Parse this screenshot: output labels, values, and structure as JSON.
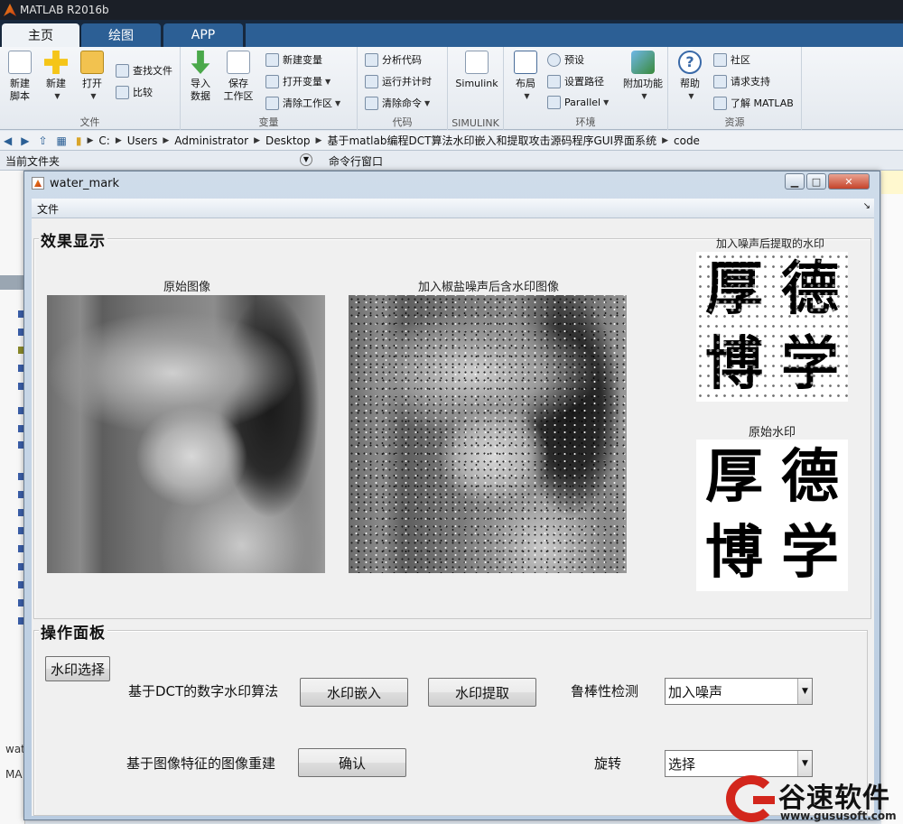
{
  "app": {
    "title": "MATLAB R2016b",
    "tabs": [
      "主页",
      "绘图",
      "APP"
    ]
  },
  "ribbon": {
    "groups": {
      "file": "文件",
      "variable": "变量",
      "code": "代码",
      "simulink": "SIMULINK",
      "environment": "环境",
      "resources": "资源"
    },
    "buttons": {
      "new_script": "新建\n脚本",
      "new": "新建",
      "open": "打开",
      "find_files": "查找文件",
      "compare": "比较",
      "import_data": "导入\n数据",
      "save_workspace": "保存\n工作区",
      "new_variable": "新建变量",
      "open_variable": "打开变量",
      "clear_workspace": "清除工作区",
      "analyze_code": "分析代码",
      "run_and_time": "运行并计时",
      "clear_commands": "清除命令",
      "simulink": "Simulink",
      "layout": "布局",
      "preferences": "预设",
      "set_path": "设置路径",
      "parallel": "Parallel",
      "add_ons": "附加功能",
      "help": "帮助",
      "community": "社区",
      "request_support": "请求支持",
      "learn_matlab": "了解 MATLAB"
    }
  },
  "address": {
    "crumbs": [
      "C:",
      "Users",
      "Administrator",
      "Desktop",
      "基于matlab编程DCT算法水印嵌入和提取攻击源码程序GUI界面系统",
      "code"
    ]
  },
  "panels": {
    "current_folder": "当前文件夹",
    "command_window": "命令行窗口",
    "left_partial_1": "wat",
    "left_partial_2": "MA"
  },
  "gui": {
    "title": "water_mark",
    "menu_file": "文件",
    "menu_dock": "↘",
    "effect_panel_title": "效果显示",
    "ops_panel_title": "操作面板",
    "images": {
      "original_caption": "原始图像",
      "noisy_caption": "加入椒盐噪声后含水印图像",
      "extracted_caption": "加入噪声后提取的水印",
      "original_watermark_caption": "原始水印",
      "watermark_chars": [
        "厚",
        "德",
        "博",
        "学"
      ]
    },
    "controls": {
      "watermark_select": "水印选择",
      "dct_label": "基于DCT的数字水印算法",
      "embed": "水印嵌入",
      "extract": "水印提取",
      "robustness_label": "鲁棒性检测",
      "robustness_value": "加入噪声",
      "rebuild_label": "基于图像特征的图像重建",
      "confirm": "确认",
      "rotate_label": "旋转",
      "rotate_value": "选择"
    }
  },
  "brand": {
    "name": "谷速软件",
    "url": "www.gususoft.com"
  }
}
